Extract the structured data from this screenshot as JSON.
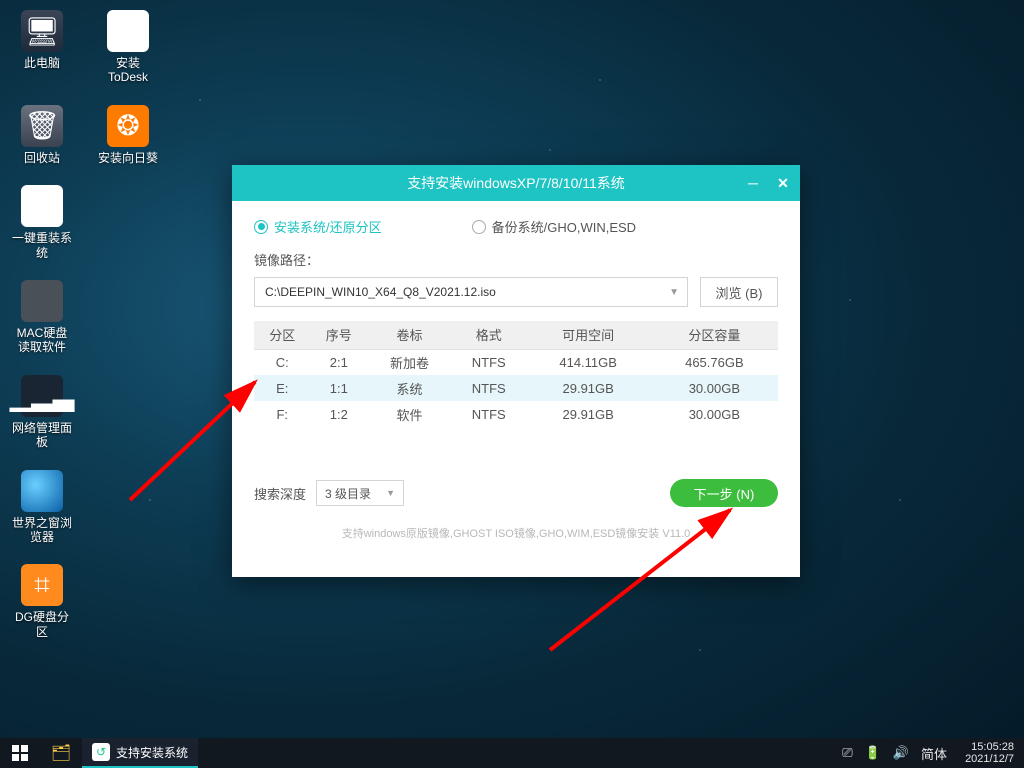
{
  "desktop": {
    "icons": [
      {
        "label": "此电脑",
        "glyph": "🖥"
      },
      {
        "label": "安装ToDesk",
        "glyph": "⎙"
      },
      {
        "label": "回收站",
        "glyph": "🗑"
      },
      {
        "label": "安装向日葵",
        "glyph": "❂"
      },
      {
        "label": "一键重装系统",
        "glyph": "↺"
      },
      {
        "label": "MAC硬盘读取软件",
        "glyph": ""
      },
      {
        "label": "网络管理面板",
        "glyph": "▁▂▃"
      },
      {
        "label": "世界之窗浏览器",
        "glyph": "🌐"
      },
      {
        "label": "DG硬盘分区",
        "glyph": "⌗"
      }
    ]
  },
  "window": {
    "title": "支持安装windowsXP/7/8/10/11系统",
    "tab_install": "安装系统/还原分区",
    "tab_backup": "备份系统/GHO,WIN,ESD",
    "path_label": "镜像路径：",
    "path_value": "C:\\DEEPIN_WIN10_X64_Q8_V2021.12.iso",
    "browse": "浏览 (B)",
    "columns": [
      "分区",
      "序号",
      "卷标",
      "格式",
      "可用空间",
      "分区容量"
    ],
    "rows": [
      {
        "part": "C:",
        "ord": "2:1",
        "vol": "新加卷",
        "fmt": "NTFS",
        "free": "414.11GB",
        "cap": "465.76GB"
      },
      {
        "part": "E:",
        "ord": "1:1",
        "vol": "系统",
        "fmt": "NTFS",
        "free": "29.91GB",
        "cap": "30.00GB"
      },
      {
        "part": "F:",
        "ord": "1:2",
        "vol": "软件",
        "fmt": "NTFS",
        "free": "29.91GB",
        "cap": "30.00GB"
      }
    ],
    "depth_label": "搜索深度",
    "depth_value": "3 级目录",
    "next": "下一步 (N)",
    "hint": "支持windows原版镜像,GHOST ISO镜像,GHO,WIM,ESD镜像安装 V11.0"
  },
  "taskbar": {
    "app": "支持安装系统",
    "ime": "简体",
    "time": "15:05:28",
    "date": "2021/12/7"
  }
}
